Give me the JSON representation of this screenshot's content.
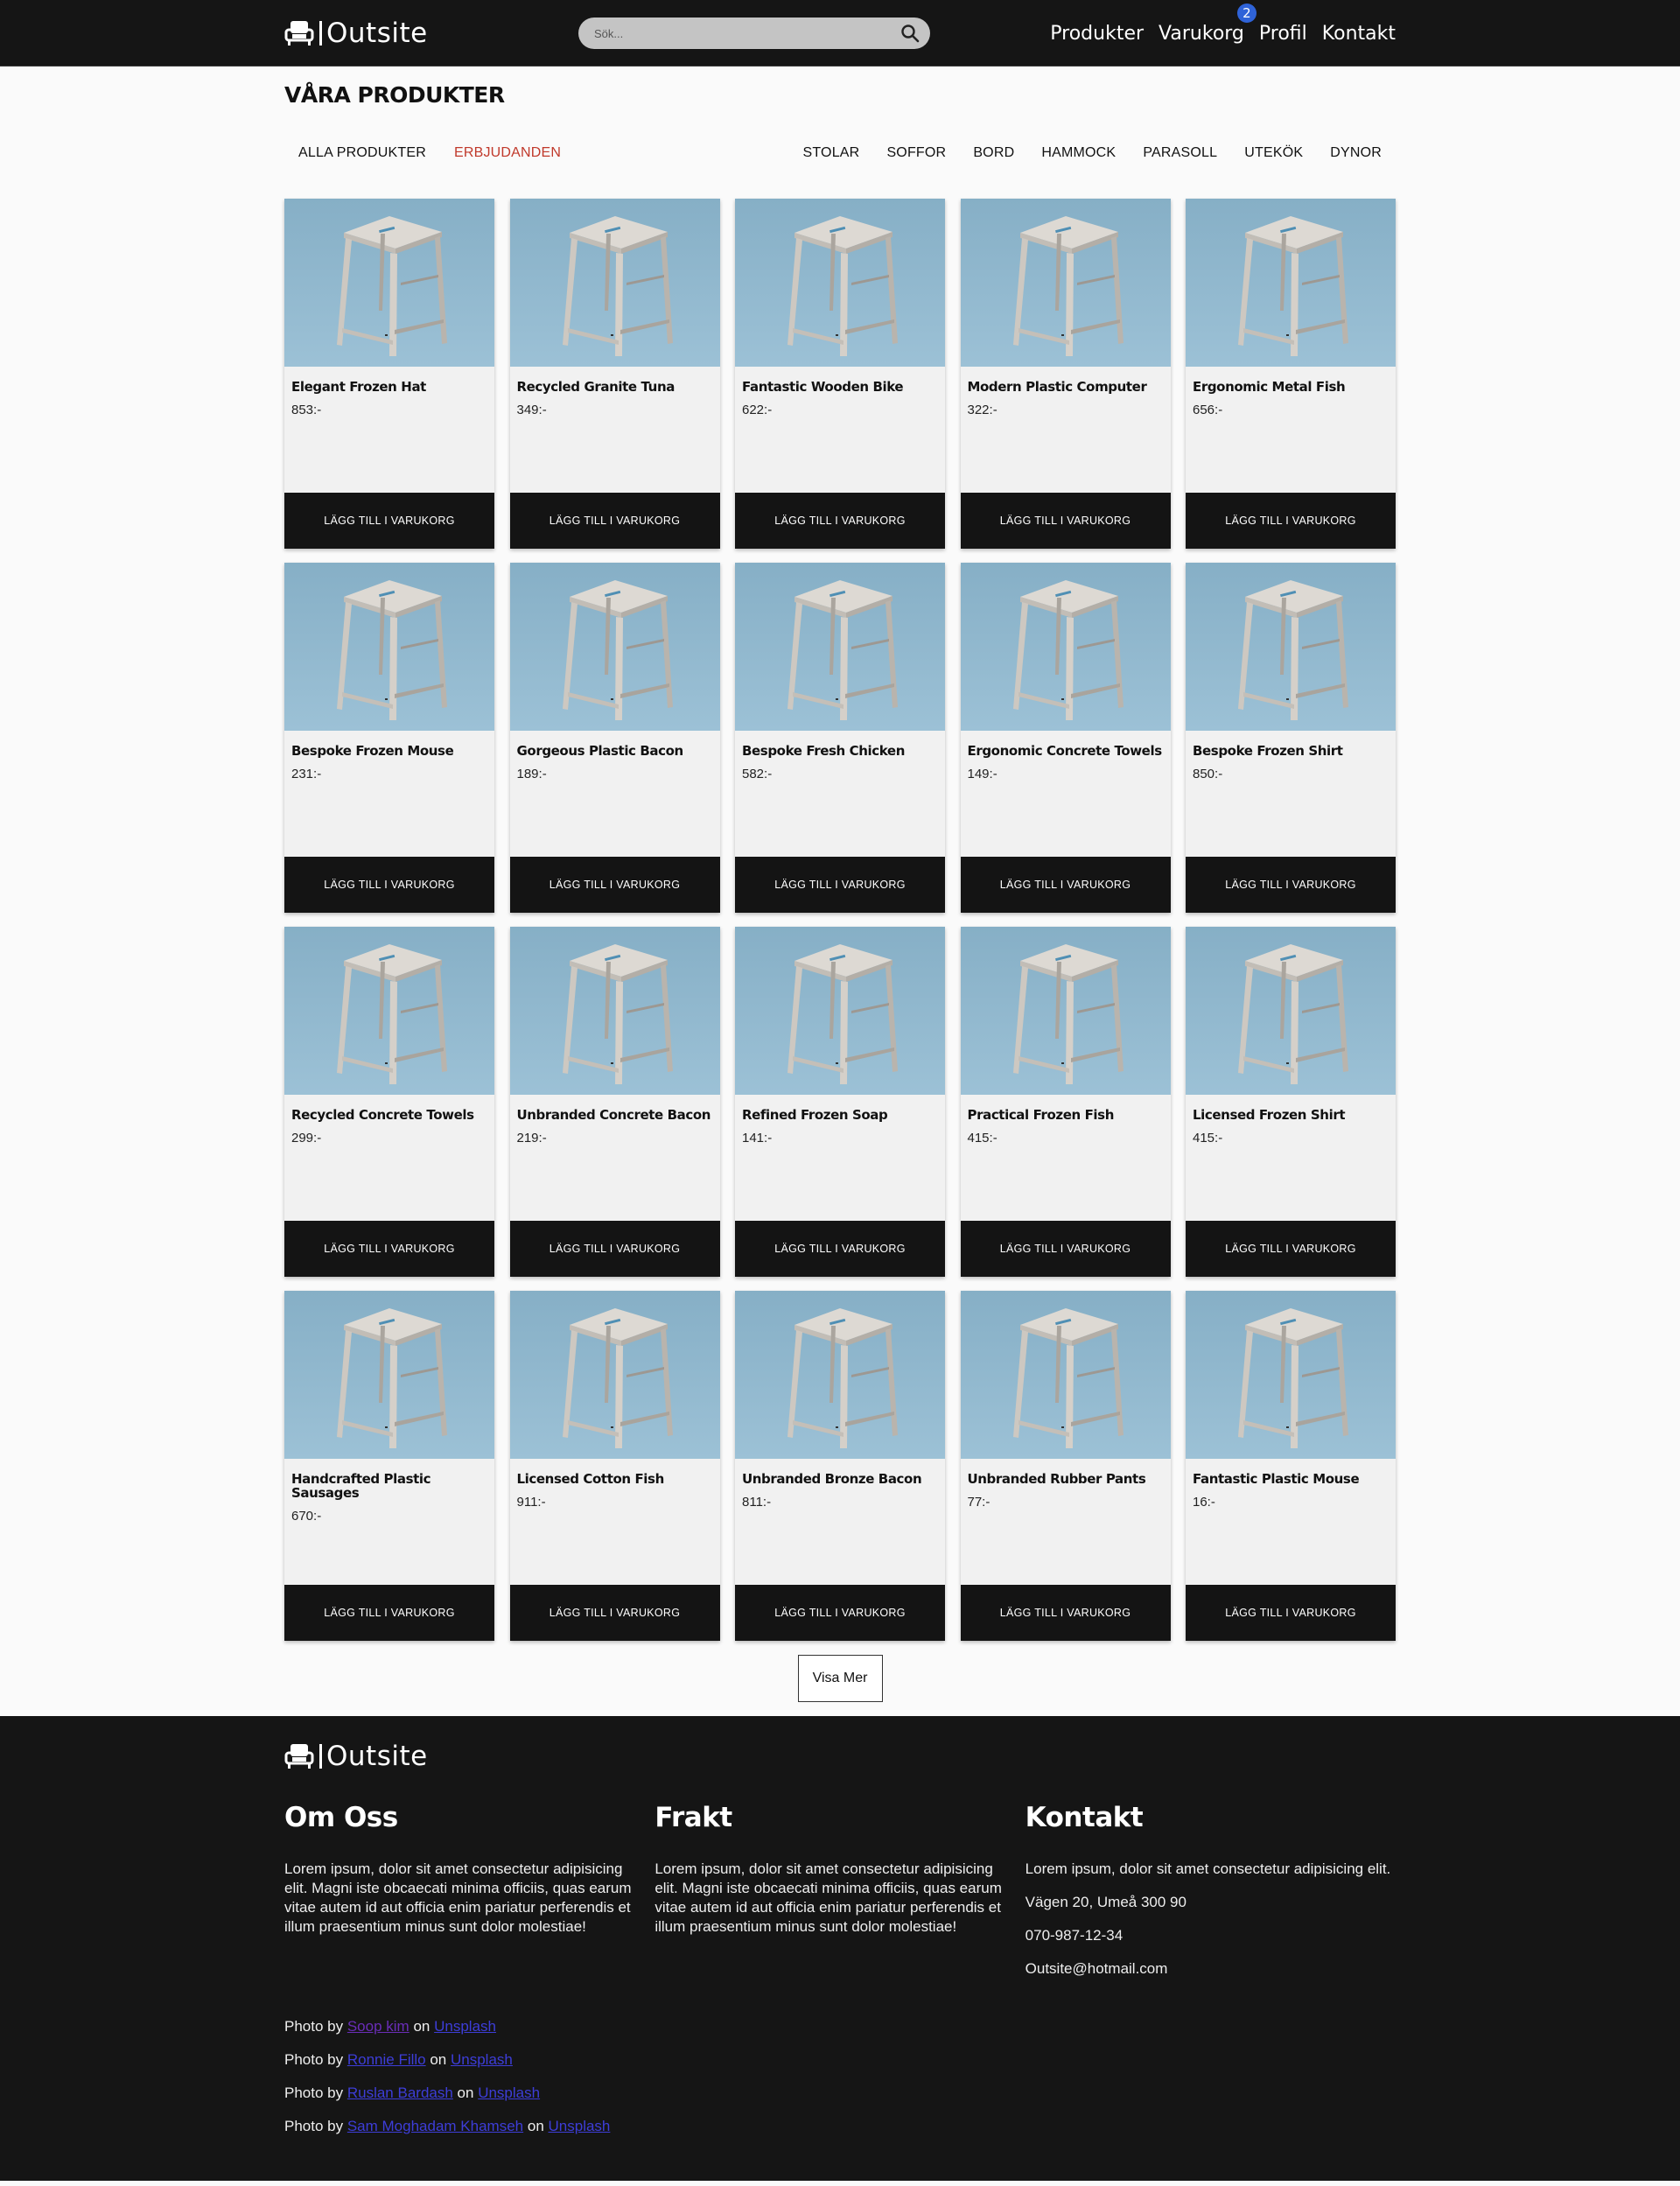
{
  "header": {
    "brand": "Outsite",
    "search_placeholder": "Sök...",
    "nav": [
      "Produkter",
      "Varukorg",
      "Profil",
      "Kontakt"
    ],
    "cart_count": "2"
  },
  "page_title": "VÅRA PRODUKTER",
  "filters": {
    "left": [
      "ALLA PRODUKTER",
      "ERBJUDANDEN"
    ],
    "right": [
      "STOLAR",
      "SOFFOR",
      "BORD",
      "HAMMOCK",
      "PARASOLL",
      "UTEKÖK",
      "DYNOR"
    ]
  },
  "add_to_cart_label": "LÄGG TILL I VARUKORG",
  "products": [
    {
      "name": "Elegant Frozen Hat",
      "price": "853:-"
    },
    {
      "name": "Recycled Granite Tuna",
      "price": "349:-"
    },
    {
      "name": "Fantastic Wooden Bike",
      "price": "622:-"
    },
    {
      "name": "Modern Plastic Computer",
      "price": "322:-"
    },
    {
      "name": "Ergonomic Metal Fish",
      "price": "656:-"
    },
    {
      "name": "Bespoke Frozen Mouse",
      "price": "231:-"
    },
    {
      "name": "Gorgeous Plastic Bacon",
      "price": "189:-"
    },
    {
      "name": "Bespoke Fresh Chicken",
      "price": "582:-"
    },
    {
      "name": "Ergonomic Concrete Towels",
      "price": "149:-"
    },
    {
      "name": "Bespoke Frozen Shirt",
      "price": "850:-"
    },
    {
      "name": "Recycled Concrete Towels",
      "price": "299:-"
    },
    {
      "name": "Unbranded Concrete Bacon",
      "price": "219:-"
    },
    {
      "name": "Refined Frozen Soap",
      "price": "141:-"
    },
    {
      "name": "Practical Frozen Fish",
      "price": "415:-"
    },
    {
      "name": "Licensed Frozen Shirt",
      "price": "415:-"
    },
    {
      "name": "Handcrafted Plastic Sausages",
      "price": "670:-"
    },
    {
      "name": "Licensed Cotton Fish",
      "price": "911:-"
    },
    {
      "name": "Unbranded Bronze Bacon",
      "price": "811:-"
    },
    {
      "name": "Unbranded Rubber Pants",
      "price": "77:-"
    },
    {
      "name": "Fantastic Plastic Mouse",
      "price": "16:-"
    }
  ],
  "show_more_label": "Visa Mer",
  "footer": {
    "brand": "Outsite",
    "about": {
      "title": "Om Oss",
      "text": "Lorem ipsum, dolor sit amet consectetur adipisicing elit. Magni iste obcaecati minima officiis, quas earum vitae autem id aut officia enim pariatur perferendis et illum praesentium minus sunt dolor molestiae!"
    },
    "shipping": {
      "title": "Frakt",
      "text": "Lorem ipsum, dolor sit amet consectetur adipisicing elit. Magni iste obcaecati minima officiis, quas earum vitae autem id aut officia enim pariatur perferendis et illum praesentium minus sunt dolor molestiae!"
    },
    "contact": {
      "title": "Kontakt",
      "text": "Lorem ipsum, dolor sit amet consectetur adipisicing elit.",
      "address": "Vägen 20, Umeå 300 90",
      "phone": "070-987-12-34",
      "email": "Outsite@hotmail.com"
    },
    "credits": [
      {
        "prefix": "Photo by",
        "author": "Soop kim",
        "on": "on",
        "site": "Unsplash"
      },
      {
        "prefix": "Photo by",
        "author": "Ronnie Fillo",
        "on": "on",
        "site": "Unsplash"
      },
      {
        "prefix": "Photo by",
        "author": "Ruslan Bardash",
        "on": "on",
        "site": "Unsplash"
      },
      {
        "prefix": "Photo by",
        "author": "Sam Moghadam Khamseh",
        "on": "on",
        "site": "Unsplash"
      }
    ]
  },
  "colors": {
    "nav_bg": "#151515",
    "offer_red": "#c0392b",
    "badge_blue": "#2f63d8",
    "button_bg": "#141414",
    "link_blue": "#3d3dd8",
    "link_visited": "#6a2db8"
  }
}
